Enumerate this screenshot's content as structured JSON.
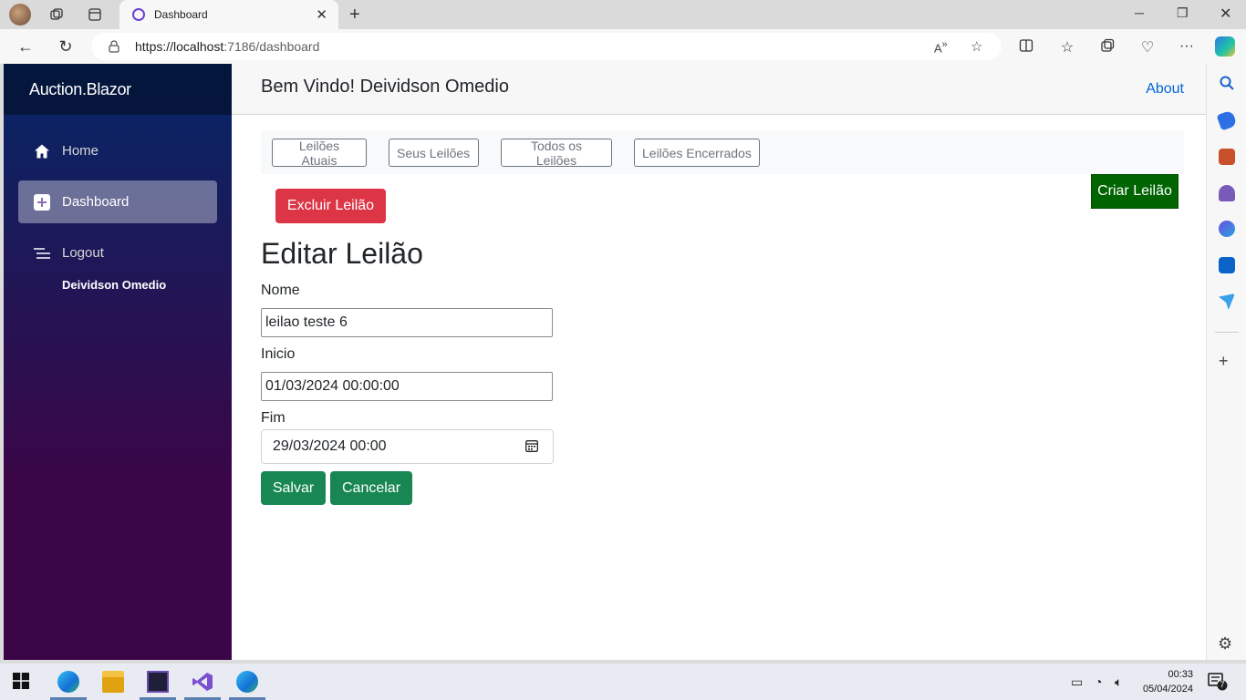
{
  "browser": {
    "tab_title": "Dashboard",
    "url_host": "https://localhost",
    "url_rest": ":7186/dashboard"
  },
  "app": {
    "brand": "Auction.Blazor",
    "nav": [
      {
        "label": "Home",
        "icon": "home-icon"
      },
      {
        "label": "Dashboard",
        "icon": "plus-square-icon",
        "active": true
      },
      {
        "label": "Logout",
        "icon": "list-icon"
      }
    ],
    "username": "Deividson Omedio",
    "welcome": "Bem Vindo! Deividson Omedio",
    "about": "About",
    "tabs": [
      "Leilões Atuais",
      "Seus Leilões",
      "Todos os Leilões",
      "Leilões Encerrados"
    ],
    "create_button": "Criar Leilão",
    "delete_button": "Excluir Leilão",
    "page_title": "Editar Leilão",
    "form": {
      "name_label": "Nome",
      "name_value": "leilao teste 6",
      "start_label": "Inicio",
      "start_value": "01/03/2024 00:00:00",
      "end_label": "Fim",
      "end_value": "29/03/2024 00:00"
    },
    "save_button": "Salvar",
    "cancel_button": "Cancelar"
  },
  "taskbar": {
    "time": "00:33",
    "date": "05/04/2024",
    "notification_count": "7"
  },
  "colors": {
    "sidebar_top": "#052767",
    "sidebar_bottom": "#3a0647",
    "create": "#006400",
    "delete": "#dc3545",
    "save": "#198754",
    "link": "#0366d6"
  }
}
